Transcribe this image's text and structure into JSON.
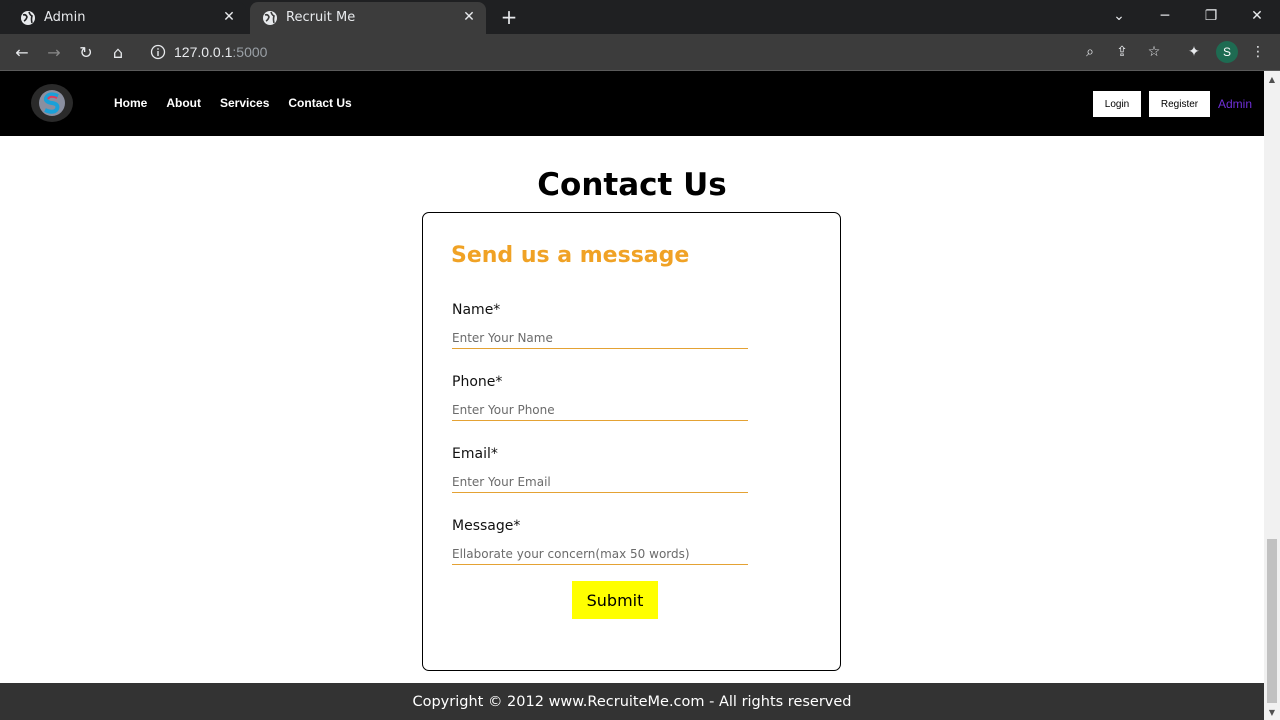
{
  "browser": {
    "tabs": [
      {
        "title": "Admin",
        "active": false
      },
      {
        "title": "Recruit Me",
        "active": true
      }
    ],
    "url_host": "127.0.0.1",
    "url_port": ":5000",
    "profile_initial": "S"
  },
  "nav": {
    "links": [
      "Home",
      "About",
      "Services",
      "Contact Us"
    ],
    "login": "Login",
    "register": "Register",
    "admin": "Admin"
  },
  "page": {
    "title": "Contact Us",
    "form": {
      "heading": "Send us a message",
      "fields": [
        {
          "label": "Name*",
          "placeholder": "Enter Your Name",
          "value": ""
        },
        {
          "label": "Phone*",
          "placeholder": "Enter Your Phone",
          "value": ""
        },
        {
          "label": "Email*",
          "placeholder": "Enter Your Email",
          "value": ""
        },
        {
          "label": "Message*",
          "placeholder": "Ellaborate your concern(max 50 words)",
          "value": ""
        }
      ],
      "submit": "Submit"
    }
  },
  "footer": {
    "text": "Copyright © 2012 www.RecruiteMe.com - All rights reserved"
  },
  "colors": {
    "accent": "#f0a225",
    "submit_bg": "#ffff00",
    "admin_link": "#6f2fd8",
    "navbar_bg": "#000000",
    "footer_bg": "#333333"
  }
}
